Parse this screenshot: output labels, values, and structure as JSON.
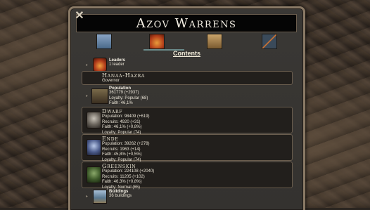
{
  "window": {
    "title": "Azov Warrens",
    "close_glyph": "✕"
  },
  "tabs": [
    {
      "name": "region-icon"
    },
    {
      "name": "crown-icon"
    },
    {
      "name": "buildings-icon"
    },
    {
      "name": "trade-icon"
    }
  ],
  "contents_title": "Contents",
  "leaders": {
    "title": "Leaders",
    "count": "1 leader"
  },
  "governor": {
    "name": "Hanaa-Hazra",
    "role": "Governor"
  },
  "population": {
    "title": "Population",
    "total": "361779 (+2937)",
    "loyalty": "Loyalty: Popular (68)",
    "faith": "Faith: 46,1%"
  },
  "races": [
    {
      "name": "Dwarf",
      "population": "Population: 98409 (+619)",
      "recruits": "Recruits: 4920 (+31)",
      "faith": "Faith: 46,1% (+0,8%)",
      "loyalty": "Loyalty: Popular (74)"
    },
    {
      "name": "Ende",
      "population": "Population: 39262 (+278)",
      "recruits": "Recruits: 1963 (+14)",
      "faith": "Faith: 45,8% (+0,5%)",
      "loyalty": "Loyalty: Popular (74)"
    },
    {
      "name": "Greenskin",
      "population": "Population: 224108 (+2040)",
      "recruits": "Recruits: 11205 (+102)",
      "faith": "Faith: 46,3% (+0,8%)",
      "loyalty": "Loyalty: Normal (65)"
    }
  ],
  "buildings": {
    "title": "Buildings",
    "count": "36 buildings"
  },
  "colors": {
    "panel_border": "#8a7a66",
    "title_bar": "#050505",
    "accent_underline": "#6a8a8a"
  }
}
